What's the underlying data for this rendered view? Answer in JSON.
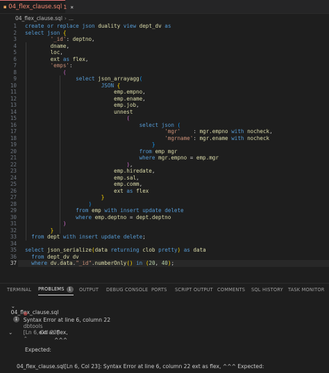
{
  "tab": {
    "icon": "db-file-icon",
    "title": "04_flex_clause.sql",
    "count": "1",
    "close": "×"
  },
  "breadcrumb": {
    "file": "04_flex_clause.sql",
    "sep": "›",
    "more": "..."
  },
  "code_lines": [
    {
      "n": "1",
      "html": "<span style='color:#569cd6'>create or replace</span> <span style='color:#569cd6'>json</span> <span style='color:#dcdcaa'>duality</span> <span style='color:#569cd6'>view</span> <span style='color:#dcdcaa'>dept_dv</span> <span style='color:#569cd6'>as</span>"
    },
    {
      "n": "2",
      "html": "<span style='color:#569cd6'>select</span> <span style='color:#569cd6'>json</span> <span style='color:#ffd700'>{</span>"
    },
    {
      "n": "3",
      "html": "        <span style='color:#ce9178'>'_id'</span>: <span style='color:#dcdcaa'>deptno</span>,"
    },
    {
      "n": "4",
      "html": "        <span style='color:#dcdcaa'>dname</span>,"
    },
    {
      "n": "5",
      "html": "        <span style='color:#dcdcaa'>loc</span>,"
    },
    {
      "n": "6",
      "html": "        <span style='color:#dcdcaa'>ext</span> <span style='color:#569cd6'>as</span> <span style='color:#dcdcaa'>flex</span>,"
    },
    {
      "n": "7",
      "html": "        <span style='color:#ce9178'>'emps'</span>:"
    },
    {
      "n": "8",
      "html": "            <span style='color:#da70d6'>(</span>"
    },
    {
      "n": "9",
      "html": "                <span style='color:#569cd6'>select</span> <span style='color:#dcdcaa'>json_arrayagg</span><span style='color:#179fff'>(</span>"
    },
    {
      "n": "10",
      "html": "                        <span style='color:#569cd6'>JSON</span> <span style='color:#ffd700'>{</span>"
    },
    {
      "n": "11",
      "html": "                            <span style='color:#dcdcaa'>emp.empno</span>,"
    },
    {
      "n": "12",
      "html": "                            <span style='color:#dcdcaa'>emp.ename</span>,"
    },
    {
      "n": "13",
      "html": "                            <span style='color:#dcdcaa'>emp.job</span>,"
    },
    {
      "n": "14",
      "html": "                            <span style='color:#dcdcaa'>unnest</span>"
    },
    {
      "n": "15",
      "html": "                                <span style='color:#da70d6'>(</span>"
    },
    {
      "n": "16",
      "html": "                                    <span style='color:#569cd6'>select</span> <span style='color:#569cd6'>json</span> <span style='color:#179fff'>(</span>"
    },
    {
      "n": "17",
      "html": "                                            <span style='color:#ce9178'>'mgr'</span>    : <span style='color:#dcdcaa'>mgr.empno</span> <span style='color:#569cd6'>with</span> <span style='color:#dcdcaa'>nocheck</span>,"
    },
    {
      "n": "18",
      "html": "                                            <span style='color:#ce9178'>'mgrname'</span>: <span style='color:#dcdcaa'>mgr.ename</span> <span style='color:#569cd6'>with</span> <span style='color:#dcdcaa'>nocheck</span>"
    },
    {
      "n": "19",
      "html": "                                        <span style='color:#179fff'>}</span>"
    },
    {
      "n": "20",
      "html": "                                    <span style='color:#569cd6'>from</span> <span style='color:#dcdcaa'>emp mgr</span>"
    },
    {
      "n": "21",
      "html": "                                    <span style='color:#569cd6'>where</span> <span style='color:#dcdcaa'>mgr.empno</span> = <span style='color:#dcdcaa'>emp.mgr</span>"
    },
    {
      "n": "22",
      "html": "                                <span style='color:#da70d6'>)</span>,"
    },
    {
      "n": "23",
      "html": "                            <span style='color:#dcdcaa'>emp.hiredate</span>,"
    },
    {
      "n": "24",
      "html": "                            <span style='color:#dcdcaa'>emp.sal</span>,"
    },
    {
      "n": "25",
      "html": "                            <span style='color:#dcdcaa'>emp.comm</span>,"
    },
    {
      "n": "26",
      "html": "                            <span style='color:#dcdcaa'>ext</span> <span style='color:#569cd6'>as</span> <span style='color:#dcdcaa'>flex</span>"
    },
    {
      "n": "27",
      "html": "                        <span style='color:#ffd700'>}</span>"
    },
    {
      "n": "28",
      "html": "                    <span style='color:#179fff'>)</span>"
    },
    {
      "n": "29",
      "html": "                <span style='color:#569cd6'>from</span> <span style='color:#dcdcaa'>emp</span> <span style='color:#569cd6'>with insert update delete</span>"
    },
    {
      "n": "30",
      "html": "                <span style='color:#569cd6'>where</span> <span style='color:#dcdcaa'>emp.deptno</span> = <span style='color:#dcdcaa'>dept.deptno</span>"
    },
    {
      "n": "31",
      "html": "            <span style='color:#da70d6'>)</span>"
    },
    {
      "n": "32",
      "html": "        <span style='color:#ffd700'>}</span>"
    },
    {
      "n": "33",
      "html": "  <span style='color:#569cd6'>from</span> <span style='color:#dcdcaa'>dept</span> <span style='color:#569cd6'>with insert update delete</span>;"
    },
    {
      "n": "34",
      "html": ""
    },
    {
      "n": "35",
      "html": "<span style='color:#569cd6'>select</span> <span style='color:#dcdcaa'>json_serialize</span><span style='color:#ffd700'>(</span><span style='color:#dcdcaa'>data</span> <span style='color:#569cd6'>returning</span> <span style='color:#dcdcaa'>clob</span> <span style='color:#569cd6'>pretty</span><span style='color:#ffd700'>)</span> <span style='color:#569cd6'>as</span> <span style='color:#dcdcaa'>data</span>"
    },
    {
      "n": "36",
      "html": "  <span style='color:#569cd6'>from</span> <span style='color:#dcdcaa'>dept_dv dv</span>"
    },
    {
      "n": "37",
      "html": "  <span style='color:#569cd6'>where</span> <span style='color:#dcdcaa'>dv.data</span>.<span style='color:#ce9178'>\"_id\"</span>.<span style='color:#dcdcaa'>numberOnly</span><span style='color:#ffd700'>()</span> <span style='color:#569cd6'>in</span> <span style='color:#ffd700'>(</span><span style='color:#b5cea8'>20</span>, <span style='color:#b5cea8'>40</span><span style='color:#ffd700'>)</span>;"
    }
  ],
  "panel_tabs": [
    {
      "label": "TERMINAL"
    },
    {
      "label": "PROBLEMS",
      "badge": "1"
    },
    {
      "label": "OUTPUT"
    },
    {
      "label": "DEBUG CONSOLE"
    },
    {
      "label": "PORTS"
    },
    {
      "label": "SCRIPT OUTPUT"
    },
    {
      "label": "COMMENTS"
    },
    {
      "label": "SQL HISTORY"
    },
    {
      "label": "TASK MONITOR"
    }
  ],
  "problems": {
    "file": "04_flex_clause.sql",
    "file_count": "1",
    "message": "Syntax Error at line 6, column 22",
    "source": "dbtools",
    "location": "[Ln 6, Col 23]",
    "detail_line1": "ext as flex,",
    "detail_line2": "^^^",
    "expected": "Expected:",
    "summary": "04_flex_clause.sql[Ln 6, Col 23]: Syntax Error at line 6, column 22 ext as flex, ^^^ Expected:"
  },
  "colors": {
    "error": "#f14c4c",
    "tab_text": "#f48771"
  }
}
